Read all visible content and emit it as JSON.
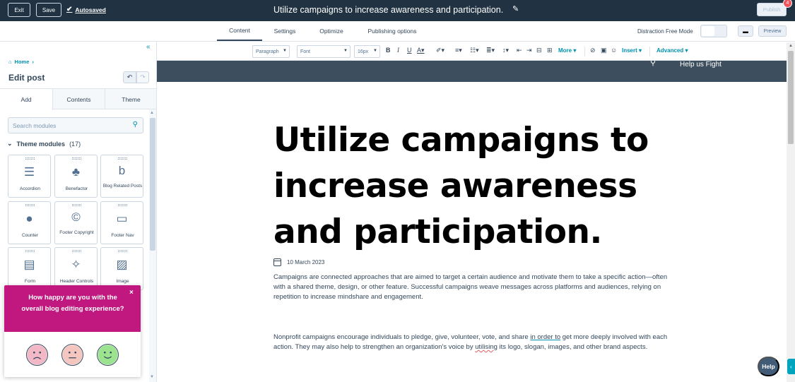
{
  "topbar": {
    "exit_label": "Exit",
    "save_label": "Save",
    "autosaved_label": "Autosaved",
    "post_title": "Utilize campaigns to increase awareness and participation.",
    "publish_label": "Publish",
    "notification_count": "4"
  },
  "tabs": {
    "items": [
      "Content",
      "Settings",
      "Optimize",
      "Publishing options"
    ],
    "active": "Content",
    "distraction_free_label": "Distraction Free Mode",
    "preview_label": "Preview"
  },
  "sidebar": {
    "breadcrumb": "Home",
    "title": "Edit post",
    "tabs": [
      "Add",
      "Contents",
      "Theme"
    ],
    "search_placeholder": "Search modules",
    "section_title": "Theme modules",
    "section_count": "(17)",
    "modules": [
      {
        "label": "Accordion",
        "icon": "accordion-icon"
      },
      {
        "label": "Benefactor",
        "icon": "benefactor-icon"
      },
      {
        "label": "Blog Related Posts",
        "icon": "blog-related-posts-icon"
      },
      {
        "label": "Counter",
        "icon": "counter-icon"
      },
      {
        "label": "Footer Copyright",
        "icon": "copyright-icon"
      },
      {
        "label": "Footer Nav",
        "icon": "footer-nav-icon"
      },
      {
        "label": "Form",
        "icon": "form-icon"
      },
      {
        "label": "Header Controls",
        "icon": "header-controls-icon"
      },
      {
        "label": "Image",
        "icon": "image-icon"
      }
    ]
  },
  "survey": {
    "question": "How happy are you with the overall blog editing experience?",
    "faces": [
      "sad-face-icon",
      "neutral-face-icon",
      "happy-face-icon"
    ],
    "face_colors": [
      "#f2b8c6",
      "#f5c6c0",
      "#9be38f"
    ]
  },
  "toolbar": {
    "paragraph": "Paragraph",
    "font": "Font",
    "size": "16px",
    "more_label": "More",
    "insert_label": "Insert",
    "advanced_label": "Advanced"
  },
  "canvas": {
    "header_link": "Help us Fight",
    "headline": "Utilize campaigns to increase awareness and participation.",
    "date": "10 March 2023",
    "para1": "Campaigns are connected approaches that are aimed to target a certain audience and motivate them to take a specific action—often with a shared theme, design, or other feature. Successful campaigns weave messages across platforms and audiences, relying on repetition to increase mindshare and engagement.",
    "para2_a": "Nonprofit campaigns encourage individuals to pledge, give, volunteer, vote, and share ",
    "para2_b": "in order to",
    "para2_c": " get more deeply involved with each action. They may also help to strengthen an organization's voice by ",
    "para2_d": "utilising",
    "para2_e": " its logo, slogan, images, and other brand aspects."
  },
  "help_label": "Help",
  "colors": {
    "topbar": "#213343",
    "accent": "#0091ae",
    "survey": "#c0187f",
    "site_header": "#3d4f5f"
  }
}
